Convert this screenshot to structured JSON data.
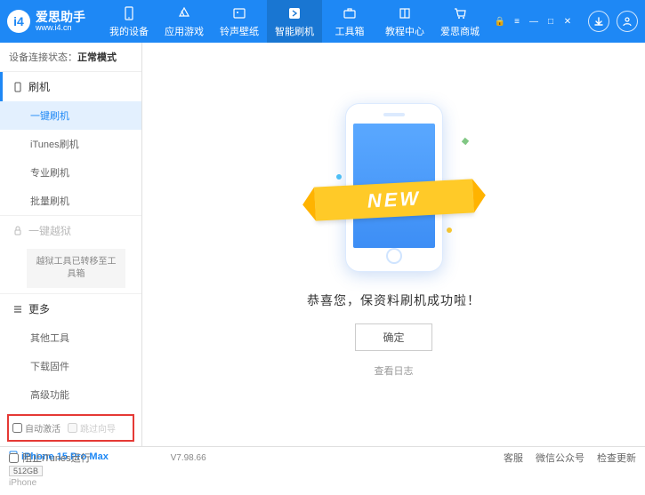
{
  "header": {
    "logo_letter": "i4",
    "app_name": "爱思助手",
    "app_url": "www.i4.cn",
    "tabs": [
      {
        "label": "我的设备"
      },
      {
        "label": "应用游戏"
      },
      {
        "label": "铃声壁纸"
      },
      {
        "label": "智能刷机"
      },
      {
        "label": "工具箱"
      },
      {
        "label": "教程中心"
      },
      {
        "label": "爱思商城"
      }
    ]
  },
  "sidebar": {
    "status_prefix": "设备连接状态：",
    "status_value": "正常模式",
    "section_flash": "刷机",
    "items_flash": [
      "一键刷机",
      "iTunes刷机",
      "专业刷机",
      "批量刷机"
    ],
    "section_jailbreak": "一键越狱",
    "jailbreak_info": "越狱工具已转移至工具箱",
    "section_more": "更多",
    "items_more": [
      "其他工具",
      "下载固件",
      "高级功能"
    ],
    "cb_auto_activate": "自动激活",
    "cb_skip_guide": "跳过向导",
    "device_name": "iPhone 15 Pro Max",
    "device_storage": "512GB",
    "device_model": "iPhone"
  },
  "main": {
    "ribbon": "NEW",
    "success": "恭喜您，保资料刷机成功啦！",
    "ok": "确定",
    "log": "查看日志"
  },
  "footer": {
    "block_itunes": "阻止iTunes运行",
    "version": "V7.98.66",
    "links": [
      "客服",
      "微信公众号",
      "检查更新"
    ]
  }
}
